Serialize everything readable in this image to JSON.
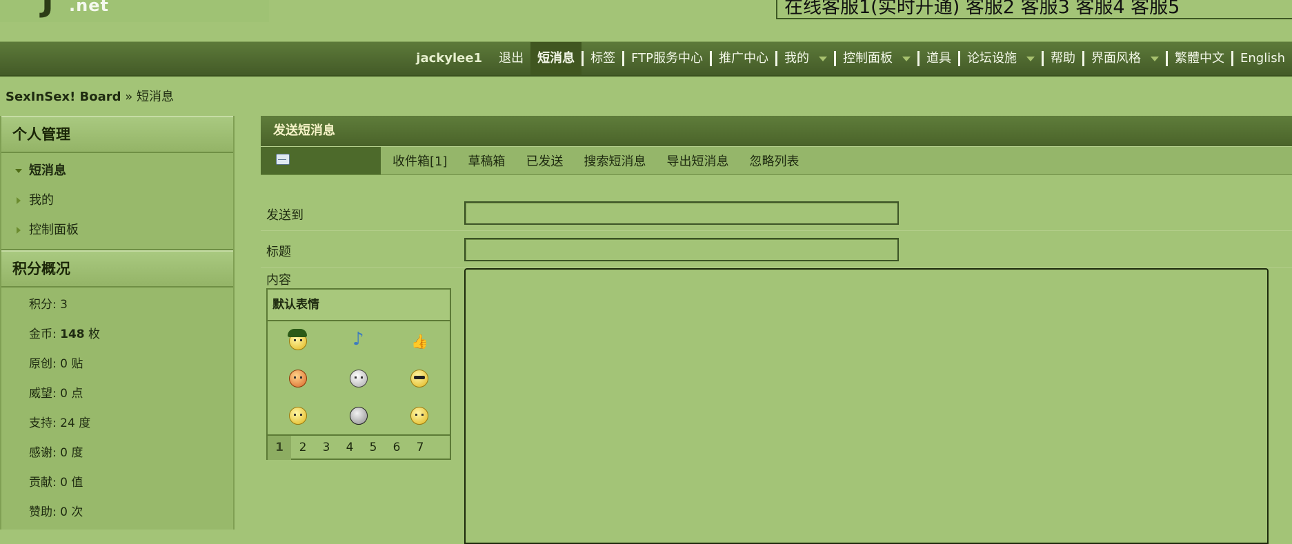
{
  "header": {
    "logo_text": ".net",
    "logo_mark": "J",
    "customer_service": "在线客服1(实时开通) 客服2 客服3 客服4 客服5"
  },
  "nav": {
    "username": "jackylee1",
    "logout": "退出",
    "items": [
      "短消息",
      "标签",
      "FTP服务中心",
      "推广中心",
      "我的",
      "控制面板",
      "道具",
      "论坛设施",
      "帮助",
      "界面风格",
      "繁體中文",
      "English"
    ]
  },
  "breadcrumb": {
    "home": "SexInSex! Board",
    "sep": "»",
    "current": "短消息"
  },
  "sidebar": {
    "personal_title": "个人管理",
    "personal_items": [
      "短消息",
      "我的",
      "控制面板"
    ],
    "credits_title": "积分概况",
    "stats": [
      {
        "label": "积分:",
        "value": "3",
        "unit": ""
      },
      {
        "label": "金币:",
        "value": "148",
        "unit": "枚"
      },
      {
        "label": "原创:",
        "value": "0",
        "unit": "贴"
      },
      {
        "label": "威望:",
        "value": "0",
        "unit": "点"
      },
      {
        "label": "支持:",
        "value": "24",
        "unit": "度"
      },
      {
        "label": "感谢:",
        "value": "0",
        "unit": "度"
      },
      {
        "label": "贡献:",
        "value": "0",
        "unit": "值"
      },
      {
        "label": "赞助:",
        "value": "0",
        "unit": "次"
      }
    ]
  },
  "main": {
    "title": "发送短消息",
    "tabs": [
      "收件箱[1]",
      "草稿箱",
      "已发送",
      "搜索短消息",
      "导出短消息",
      "忽略列表"
    ],
    "form": {
      "to_label": "发送到",
      "to_value": "",
      "subject_label": "标题",
      "subject_value": "",
      "content_label": "内容",
      "content_value": ""
    },
    "smilies": {
      "title": "默认表情",
      "pages": [
        "1",
        "2",
        "3",
        "4",
        "5",
        "6",
        "7"
      ],
      "current_page": "1",
      "icons": [
        "soldier-smiley-icon",
        "music-note-icon",
        "thumbs-up-icon",
        "angry-smiley-icon",
        "skull-icon",
        "cool-smiley-icon",
        "hmm-smiley-icon",
        "soccer-ball-icon",
        "sleepy-smiley-icon"
      ]
    }
  },
  "colors": {
    "page_bg": "#a3c477",
    "nav_bg": "#4f6a2e",
    "title_text": "#f6f3c8"
  }
}
